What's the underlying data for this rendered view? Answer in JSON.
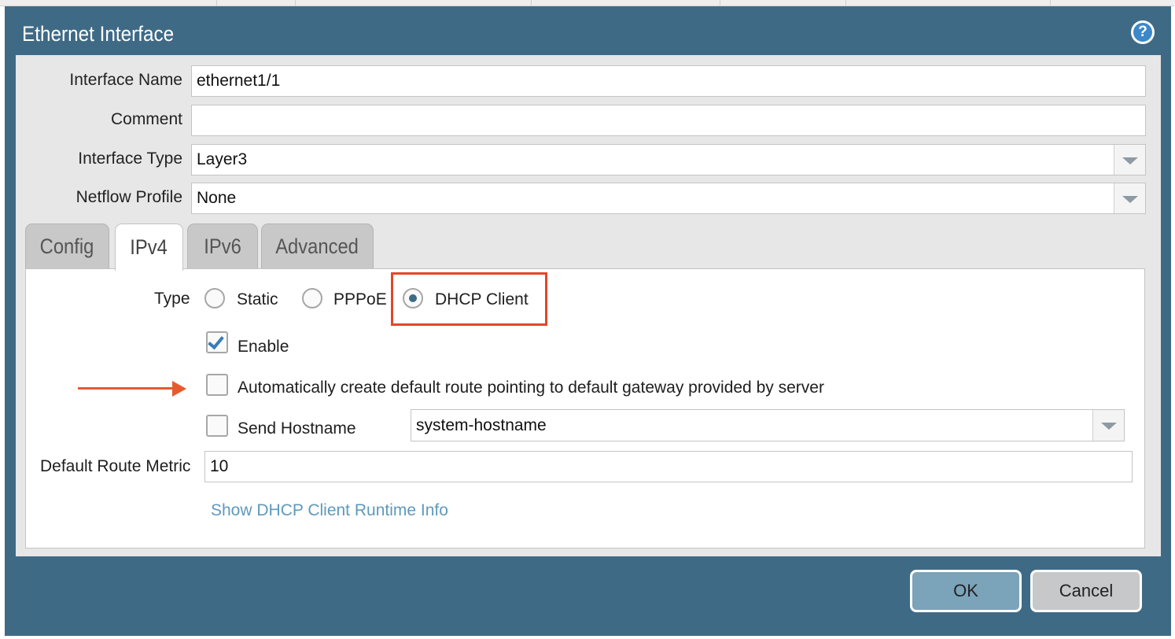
{
  "dialog": {
    "title": "Ethernet Interface",
    "help_glyph": "?"
  },
  "form": {
    "interface_name": {
      "label": "Interface Name",
      "value": "ethernet1/1"
    },
    "comment": {
      "label": "Comment",
      "value": ""
    },
    "interface_type": {
      "label": "Interface Type",
      "value": "Layer3"
    },
    "netflow_profile": {
      "label": "Netflow Profile",
      "value": "None"
    }
  },
  "tabs": [
    {
      "label": "Config",
      "active": false
    },
    {
      "label": "IPv4",
      "active": true
    },
    {
      "label": "IPv6",
      "active": false
    },
    {
      "label": "Advanced",
      "active": false
    }
  ],
  "ipv4": {
    "type_label": "Type",
    "type_options": [
      {
        "label": "Static",
        "selected": false
      },
      {
        "label": "PPPoE",
        "selected": false
      },
      {
        "label": "DHCP Client",
        "selected": true
      }
    ],
    "enable": {
      "label": "Enable",
      "checked": true
    },
    "auto_default_route": {
      "label": "Automatically create default route pointing to default gateway provided by server",
      "checked": false
    },
    "send_hostname": {
      "label": "Send Hostname",
      "checked": false,
      "value": "system-hostname"
    },
    "default_route_metric": {
      "label": "Default Route Metric",
      "value": "10"
    },
    "runtime_link": "Show DHCP Client Runtime Info"
  },
  "buttons": {
    "ok": "OK",
    "cancel": "Cancel"
  },
  "colors": {
    "dialog_header": "#3f6a86",
    "annotation": "#e2472a",
    "link": "#5f99bb",
    "ok_button": "#7ba3ba"
  },
  "icons": {
    "help": "help-icon",
    "dropdown": "chevron-down-icon",
    "checkmark": "checkmark-icon"
  }
}
